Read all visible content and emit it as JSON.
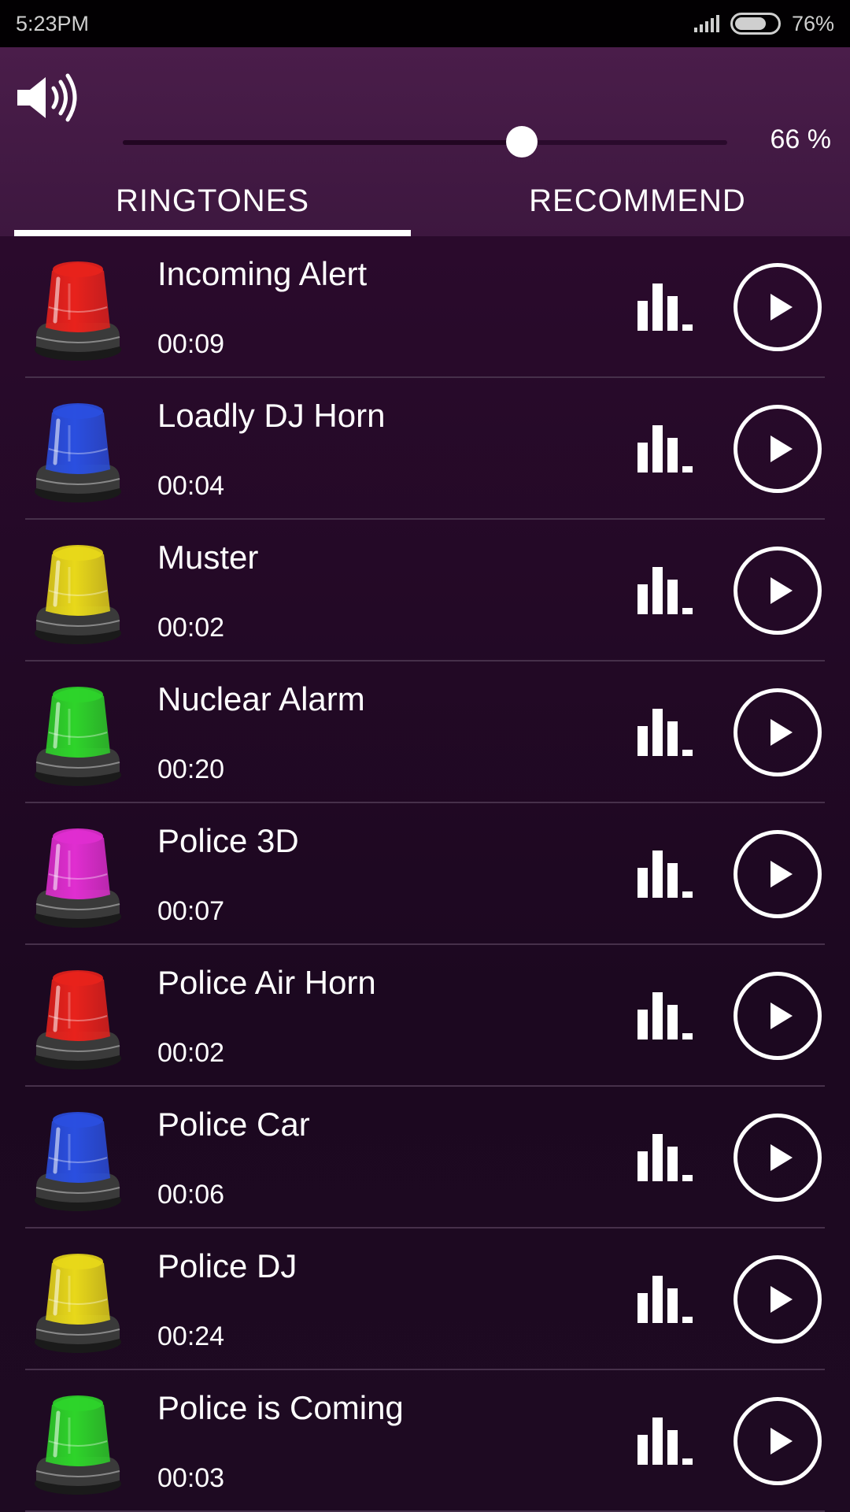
{
  "status_bar": {
    "time": "5:23PM",
    "battery": "76%"
  },
  "volume": {
    "level": 0.66,
    "label": "66 %"
  },
  "tabs": [
    {
      "label": "RINGTONES",
      "active": true
    },
    {
      "label": "RECOMMEND",
      "active": false
    }
  ],
  "ringtones": [
    {
      "title": "Incoming Alert",
      "duration": "00:09",
      "color": "#e8221c"
    },
    {
      "title": "Loadly DJ Horn",
      "duration": "00:04",
      "color": "#2a4fe0"
    },
    {
      "title": "Muster",
      "duration": "00:02",
      "color": "#e8d81a"
    },
    {
      "title": "Nuclear Alarm",
      "duration": "00:20",
      "color": "#2ed42a"
    },
    {
      "title": "Police 3D",
      "duration": "00:07",
      "color": "#e02ed0"
    },
    {
      "title": "Police Air Horn",
      "duration": "00:02",
      "color": "#e8221c"
    },
    {
      "title": "Police Car",
      "duration": "00:06",
      "color": "#2a4fe0"
    },
    {
      "title": "Police DJ",
      "duration": "00:24",
      "color": "#e8d81a"
    },
    {
      "title": "Police is Coming",
      "duration": "00:03",
      "color": "#2ed42a"
    }
  ],
  "icons": {
    "speaker": "speaker-volume-icon",
    "siren": "siren-light-icon",
    "equalizer": "equalizer-icon",
    "play": "play-icon"
  }
}
